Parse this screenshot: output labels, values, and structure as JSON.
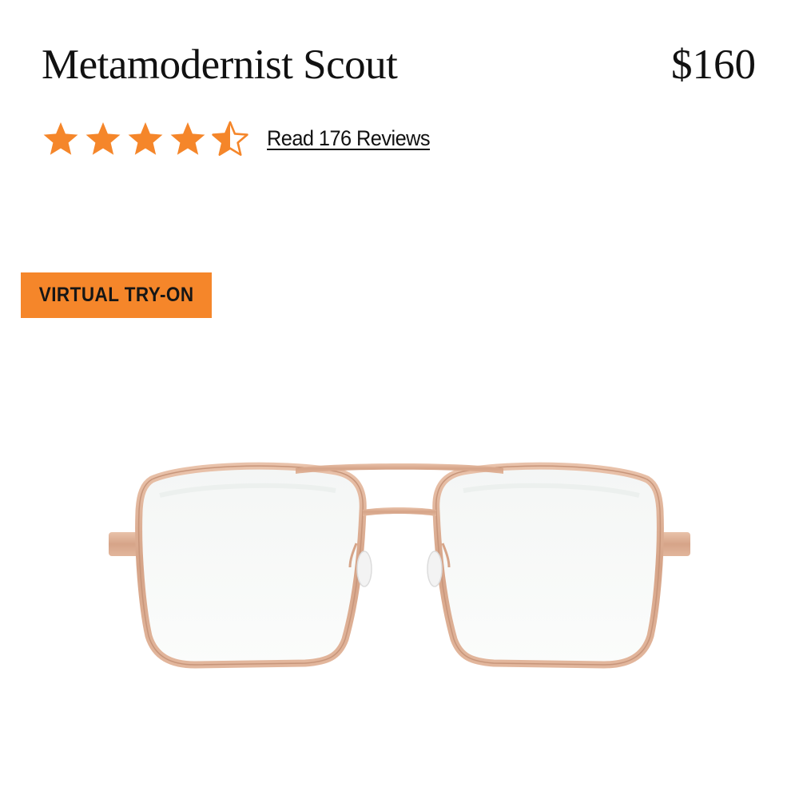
{
  "product": {
    "name": "Metamodernist Scout",
    "price": "$160"
  },
  "rating": {
    "value": 4.5,
    "max": 5,
    "reviews_link": "Read 176 Reviews"
  },
  "virtual_try_on": {
    "label": "VIRTUAL TRY-ON"
  },
  "image": {
    "subject": "rose gold aviator eyeglasses"
  },
  "colors": {
    "accent": "#f5862a",
    "star": "#f5862a",
    "frame": "#d9a98e",
    "temple": "#c9998c"
  },
  "icons": {
    "star_full": "star-icon",
    "star_half": "star-half-icon"
  }
}
